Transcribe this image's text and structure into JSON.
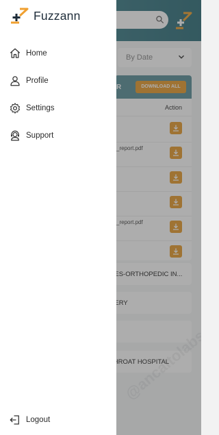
{
  "app": {
    "brand_name": "Fuzzann"
  },
  "nav": {
    "items": [
      {
        "label": "Home",
        "icon": "home-icon"
      },
      {
        "label": "Profile",
        "icon": "user-icon"
      },
      {
        "label": "Settings",
        "icon": "gear-icon"
      },
      {
        "label": "Support",
        "icon": "support-agent-icon"
      }
    ],
    "logout": {
      "label": "Logout",
      "icon": "logout-icon"
    }
  },
  "background": {
    "filter_value": "By Date",
    "download_all_label": "DOWNLOAD ALL",
    "table_header_fragment": "R",
    "action_header": "Action",
    "rows": [
      {
        "file": ""
      },
      {
        "file": "_report.pdf"
      },
      {
        "file": ""
      },
      {
        "file": ""
      },
      {
        "file": "_report.pdf"
      },
      {
        "file": ""
      }
    ],
    "cards": [
      {
        "text": "GES-ORTHOPEDIC IN..."
      },
      {
        "text": "GERY"
      },
      {
        "text": ""
      },
      {
        "text": "THROAT HOSPITAL"
      }
    ],
    "watermark": "@ancaltolabs"
  },
  "colors": {
    "brand_orange": "#f0a030",
    "brand_dark": "#1f2d3a",
    "header_teal": "#3f7f8a",
    "download_orange": "#e79c2d"
  }
}
